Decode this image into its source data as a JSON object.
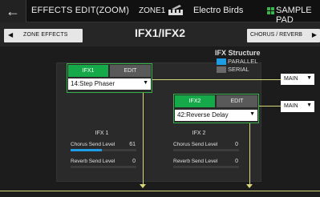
{
  "header": {
    "title": "EFFECTS EDIT(ZOOM)",
    "zone": "ZONE1",
    "tone_name": "Electro Birds",
    "sample_pad": "SAMPLE PAD"
  },
  "nav": {
    "left_label": "ZONE EFFECTS",
    "page_title": "IFX1/IFX2",
    "right_label": "CHORUS / REVERB"
  },
  "ifx1": {
    "tab_active": "IFX1",
    "tab_edit": "EDIT",
    "type_value": "14:Step Phaser",
    "section_title": "IFX 1",
    "chorus_label": "Chorus Send Level",
    "chorus_value": "61",
    "chorus_fraction": 0.48,
    "reverb_label": "Reverb Send Level",
    "reverb_value": "0",
    "reverb_fraction": 0
  },
  "ifx2": {
    "tab_active": "IFX2",
    "tab_edit": "EDIT",
    "type_value": "42:Reverse Delay",
    "section_title": "IFX 2",
    "chorus_label": "Chorus Send Level",
    "chorus_value": "0",
    "chorus_fraction": 0,
    "reverb_label": "Reverb Send Level",
    "reverb_value": "0",
    "reverb_fraction": 0
  },
  "structure": {
    "title": "IFX Structure",
    "parallel": "PARALLEL",
    "serial": "SERIAL",
    "selected": "PARALLEL"
  },
  "outputs": {
    "ifx1": "MAIN",
    "ifx2": "MAIN"
  },
  "colors": {
    "accent_green": "#16a94a",
    "accent_blue": "#1f9ce6",
    "signal_line": "#d8d77a"
  }
}
